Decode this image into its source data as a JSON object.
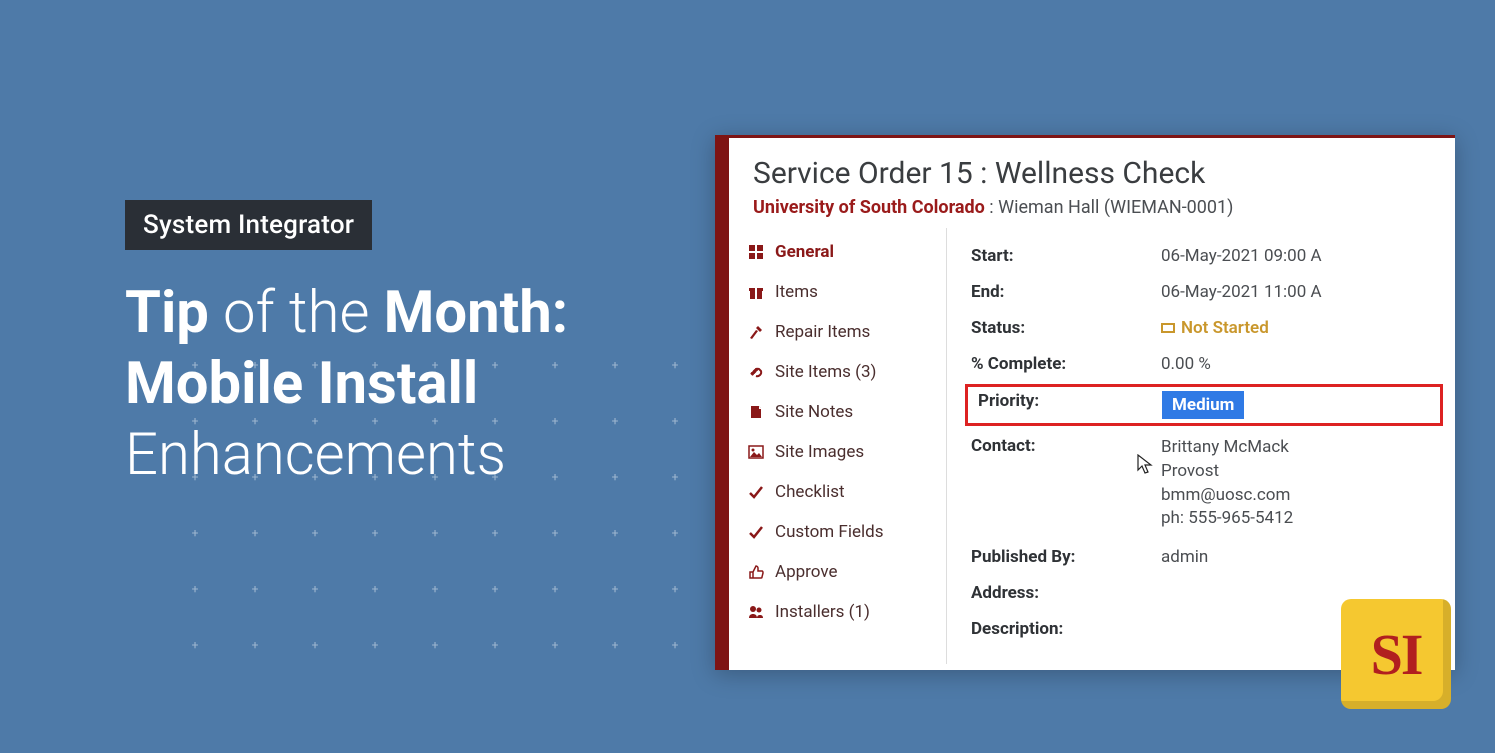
{
  "badge": "System Integrator",
  "headline": {
    "l1a": "Tip",
    "l1b": " of the ",
    "l1c": "Month:",
    "l2": "Mobile Install",
    "l3": "Enhancements"
  },
  "logo_text": "SI",
  "app": {
    "title": "Service Order 15 : Wellness Check",
    "org": "University of South Colorado",
    "site_sep": " : ",
    "site": "Wieman Hall (WIEMAN-0001)",
    "sidebar": [
      {
        "label": "General",
        "active": true,
        "icon": "grid"
      },
      {
        "label": "Items",
        "active": false,
        "icon": "gift"
      },
      {
        "label": "Repair Items",
        "active": false,
        "icon": "hammer"
      },
      {
        "label": "Site Items (3)",
        "active": false,
        "icon": "link"
      },
      {
        "label": "Site Notes",
        "active": false,
        "icon": "note"
      },
      {
        "label": "Site Images",
        "active": false,
        "icon": "image"
      },
      {
        "label": "Checklist",
        "active": false,
        "icon": "check"
      },
      {
        "label": "Custom Fields",
        "active": false,
        "icon": "check"
      },
      {
        "label": "Approve",
        "active": false,
        "icon": "thumb"
      },
      {
        "label": "Installers (1)",
        "active": false,
        "icon": "users"
      }
    ],
    "details": {
      "start_label": "Start:",
      "start_value": "06-May-2021 09:00 A",
      "end_label": "End:",
      "end_value": "06-May-2021 11:00 A",
      "status_label": "Status:",
      "status_value": "Not Started",
      "pct_label": "% Complete:",
      "pct_value": "0.00 %",
      "priority_label": "Priority:",
      "priority_value": "Medium",
      "contact_label": "Contact:",
      "contact_name": "Brittany McMack",
      "contact_title": "Provost",
      "contact_email": "bmm@uosc.com",
      "contact_phone": "ph: 555-965-5412",
      "published_label": "Published By:",
      "published_value": "admin",
      "address_label": "Address:",
      "address_value": "",
      "description_label": "Description:"
    }
  }
}
